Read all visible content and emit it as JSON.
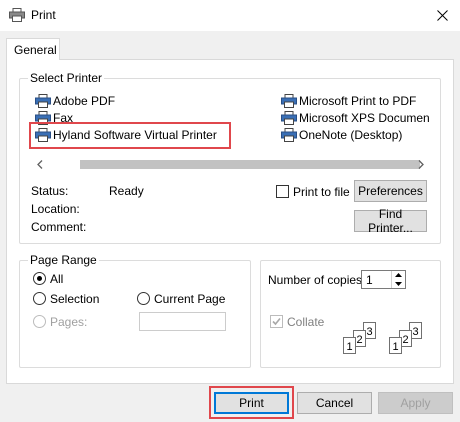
{
  "window": {
    "title": "Print",
    "title_icon": "printer-icon",
    "close_icon": "close-icon"
  },
  "tabs": [
    {
      "label": "General",
      "selected": true
    }
  ],
  "select_printer": {
    "label": "Select Printer",
    "printers": [
      {
        "name": "Adobe PDF"
      },
      {
        "name": "Fax"
      },
      {
        "name": "Hyland Software Virtual Printer",
        "highlighted": true
      },
      {
        "name": "Microsoft Print to PDF"
      },
      {
        "name": "Microsoft XPS Document Writer",
        "visible_text": "Microsoft XPS Documen"
      },
      {
        "name": "OneNote (Desktop)"
      }
    ],
    "status_label": "Status:",
    "status_value": "Ready",
    "location_label": "Location:",
    "comment_label": "Comment:",
    "print_to_file_label": "Print to file",
    "print_to_file_checked": false,
    "preferences_label": "Preferences",
    "find_printer_label": "Find Printer..."
  },
  "page_range": {
    "label": "Page Range",
    "options": [
      {
        "label": "All",
        "checked": true,
        "disabled": false
      },
      {
        "label": "Selection",
        "checked": false,
        "disabled": false
      },
      {
        "label": "Current Page",
        "checked": false,
        "disabled": false
      },
      {
        "label": "Pages:",
        "checked": false,
        "disabled": true
      }
    ],
    "pages_value": ""
  },
  "copies": {
    "label": "Number of copies:",
    "value": "1",
    "collate_label": "Collate",
    "collate_checked": true,
    "collate_disabled": true,
    "page_numbers": [
      "1",
      "2",
      "3"
    ]
  },
  "footer": {
    "print_label": "Print",
    "cancel_label": "Cancel",
    "apply_label": "Apply",
    "apply_disabled": true
  },
  "colors": {
    "highlight": "#e0474c",
    "focus": "#0078d7",
    "dialog_bg": "#f0f0f0"
  }
}
